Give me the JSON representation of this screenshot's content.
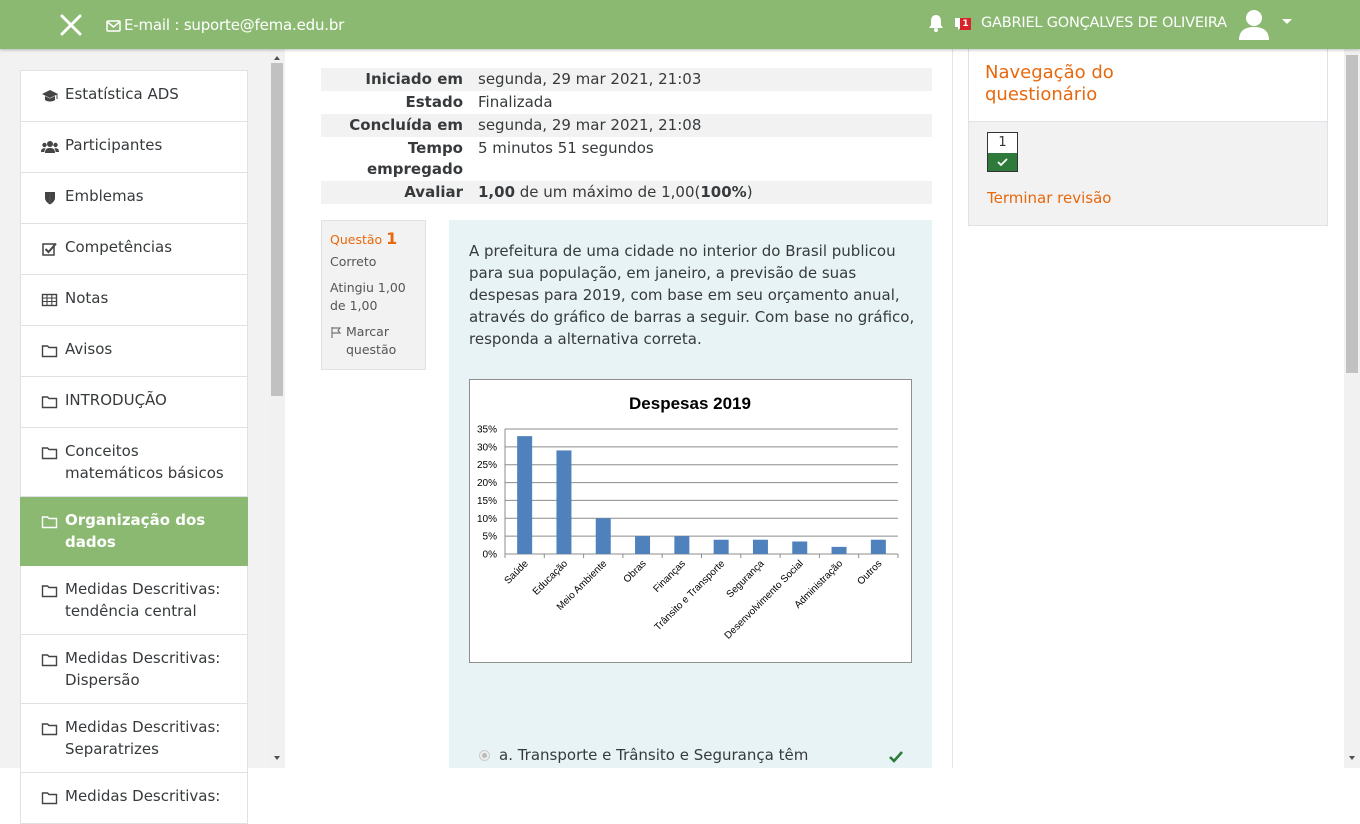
{
  "header": {
    "email": "E-mail : suporte@fema.edu.br",
    "message_count": "1",
    "user_name": "GABRIEL GONÇALVES DE OLIVEIRA"
  },
  "sidebar": {
    "items": [
      {
        "label": "Estatística ADS",
        "icon": "graduation-cap-icon"
      },
      {
        "label": "Participantes",
        "icon": "users-icon"
      },
      {
        "label": "Emblemas",
        "icon": "shield-icon"
      },
      {
        "label": "Competências",
        "icon": "checkbox-icon"
      },
      {
        "label": "Notas",
        "icon": "table-icon"
      },
      {
        "label": "Avisos",
        "icon": "folder-icon"
      },
      {
        "label": "INTRODUÇÃO",
        "icon": "folder-icon"
      },
      {
        "label": "Conceitos matemáticos básicos",
        "icon": "folder-icon"
      },
      {
        "label": "Organização dos dados",
        "icon": "folder-icon",
        "active": true
      },
      {
        "label": "Medidas Descritivas: tendência central",
        "icon": "folder-icon"
      },
      {
        "label": "Medidas Descritivas: Dispersão",
        "icon": "folder-icon"
      },
      {
        "label": "Medidas Descritivas: Separatrizes",
        "icon": "folder-icon"
      },
      {
        "label": "Medidas Descritivas:",
        "icon": "folder-icon"
      }
    ]
  },
  "summary": [
    {
      "label": "Iniciado em",
      "value": "segunda, 29 mar 2021, 21:03"
    },
    {
      "label": "Estado",
      "value": "Finalizada"
    },
    {
      "label": "Concluída em",
      "value": "segunda, 29 mar 2021, 21:08"
    },
    {
      "label": "Tempo empregado",
      "value": "5 minutos 51 segundos"
    },
    {
      "label": "Avaliar",
      "value_bold": "1,00",
      "value_mid": " de um máximo de 1,00(",
      "value_pct": "100%",
      "value_end": ")"
    }
  ],
  "question": {
    "label": "Questão",
    "number": "1",
    "state": "Correto",
    "grade": "Atingiu 1,00 de 1,00",
    "flag": "Marcar questão",
    "text": "A prefeitura de uma cidade no interior do Brasil publicou para sua população, em janeiro, a previsão de suas despesas para 2019, com base em seu orçamento anual, através do gráfico de barras a seguir.  Com base no gráfico, responda a alternativa correta.",
    "answer_a": "a. Transporte e Trânsito e Segurança têm"
  },
  "chart_data": {
    "type": "bar",
    "title": "Despesas 2019",
    "categories": [
      "Saúde",
      "Educação",
      "Meio Ambiente",
      "Obras",
      "Finanças",
      "Trânsito e Transporte",
      "Segurança",
      "Desenvolvimento Social",
      "Administração",
      "Outros"
    ],
    "values": [
      33,
      29,
      10,
      5,
      5,
      4,
      4,
      3.5,
      2,
      4
    ],
    "yticks": [
      "0%",
      "5%",
      "10%",
      "15%",
      "20%",
      "25%",
      "30%",
      "35%"
    ],
    "ylim": [
      0,
      35
    ],
    "grid": true,
    "color": "#4f81bd"
  },
  "quiz_nav": {
    "title": "Navegação do questionário",
    "button_number": "1",
    "finish_label": "Terminar revisão"
  },
  "colors": {
    "brand": "#8bb972",
    "accent": "#e8680d",
    "correct": "#2d7a3a"
  }
}
